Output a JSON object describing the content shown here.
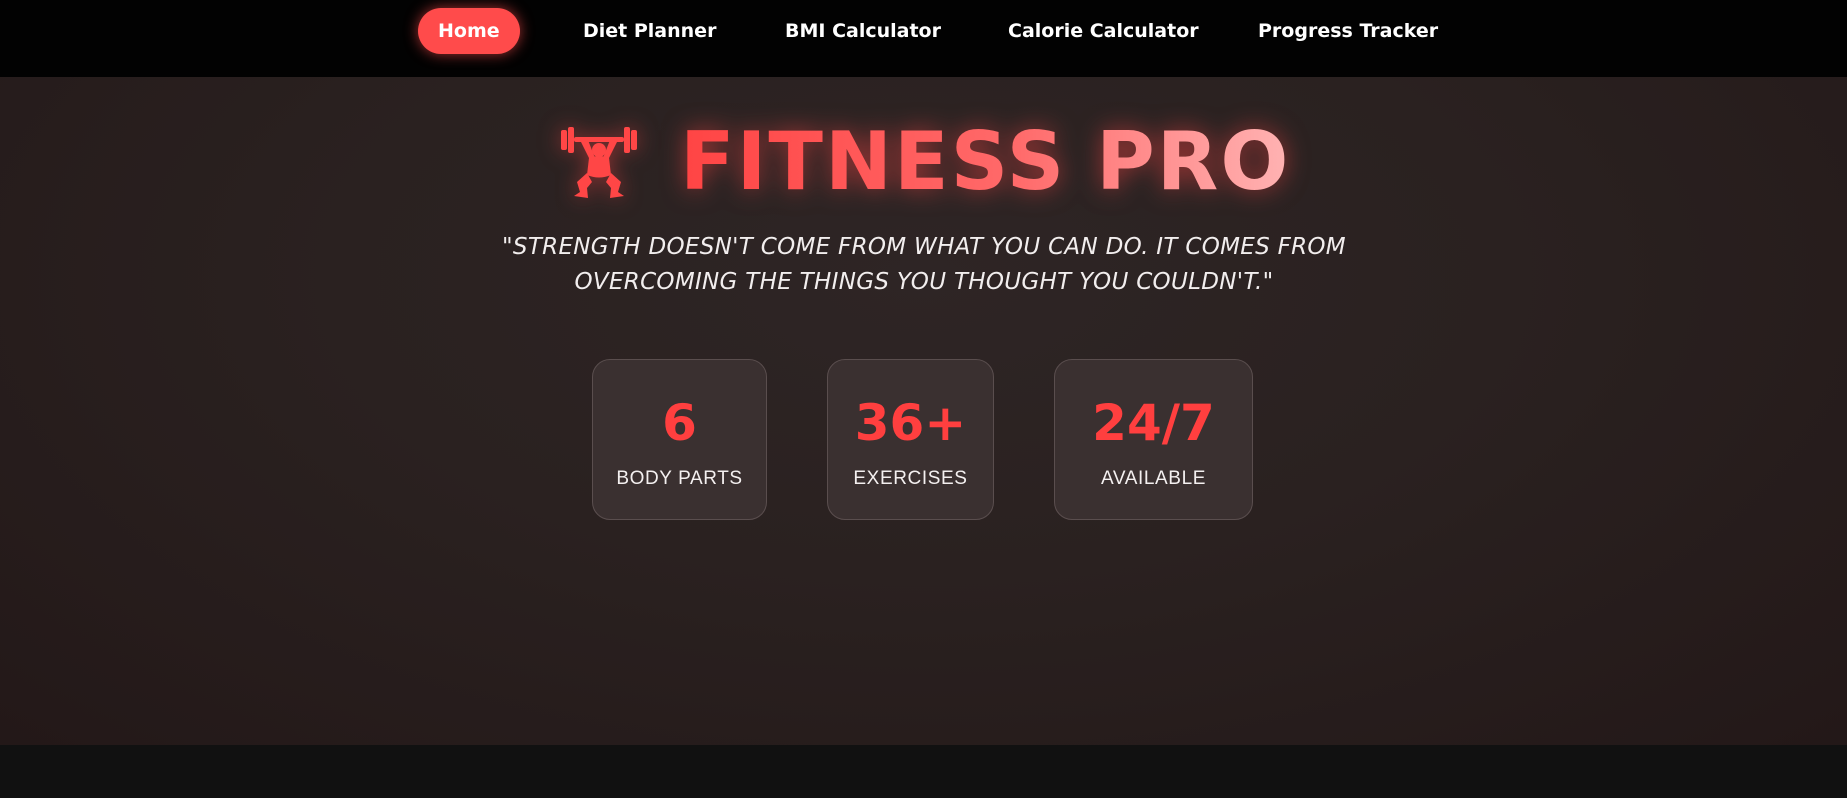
{
  "nav": {
    "items": [
      {
        "label": "Home",
        "active": true
      },
      {
        "label": "Diet Planner",
        "active": false
      },
      {
        "label": "BMI Calculator",
        "active": false
      },
      {
        "label": "Calorie Calculator",
        "active": false
      },
      {
        "label": "Progress Tracker",
        "active": false
      }
    ]
  },
  "hero": {
    "icon": "weightlifter-icon",
    "title": "FITNESS PRO",
    "quote": "\"Strength doesn't come from what you can do. It comes from overcoming the things you thought you couldn't.\""
  },
  "stats": [
    {
      "value": "6",
      "label": "BODY PARTS"
    },
    {
      "value": "36+",
      "label": "EXERCISES"
    },
    {
      "value": "24/7",
      "label": "AVAILABLE"
    }
  ],
  "colors": {
    "accent": "#ff4b4b",
    "nav_background": "#020202",
    "hero_background": "#2a2120",
    "card_background": "#3a3030"
  }
}
